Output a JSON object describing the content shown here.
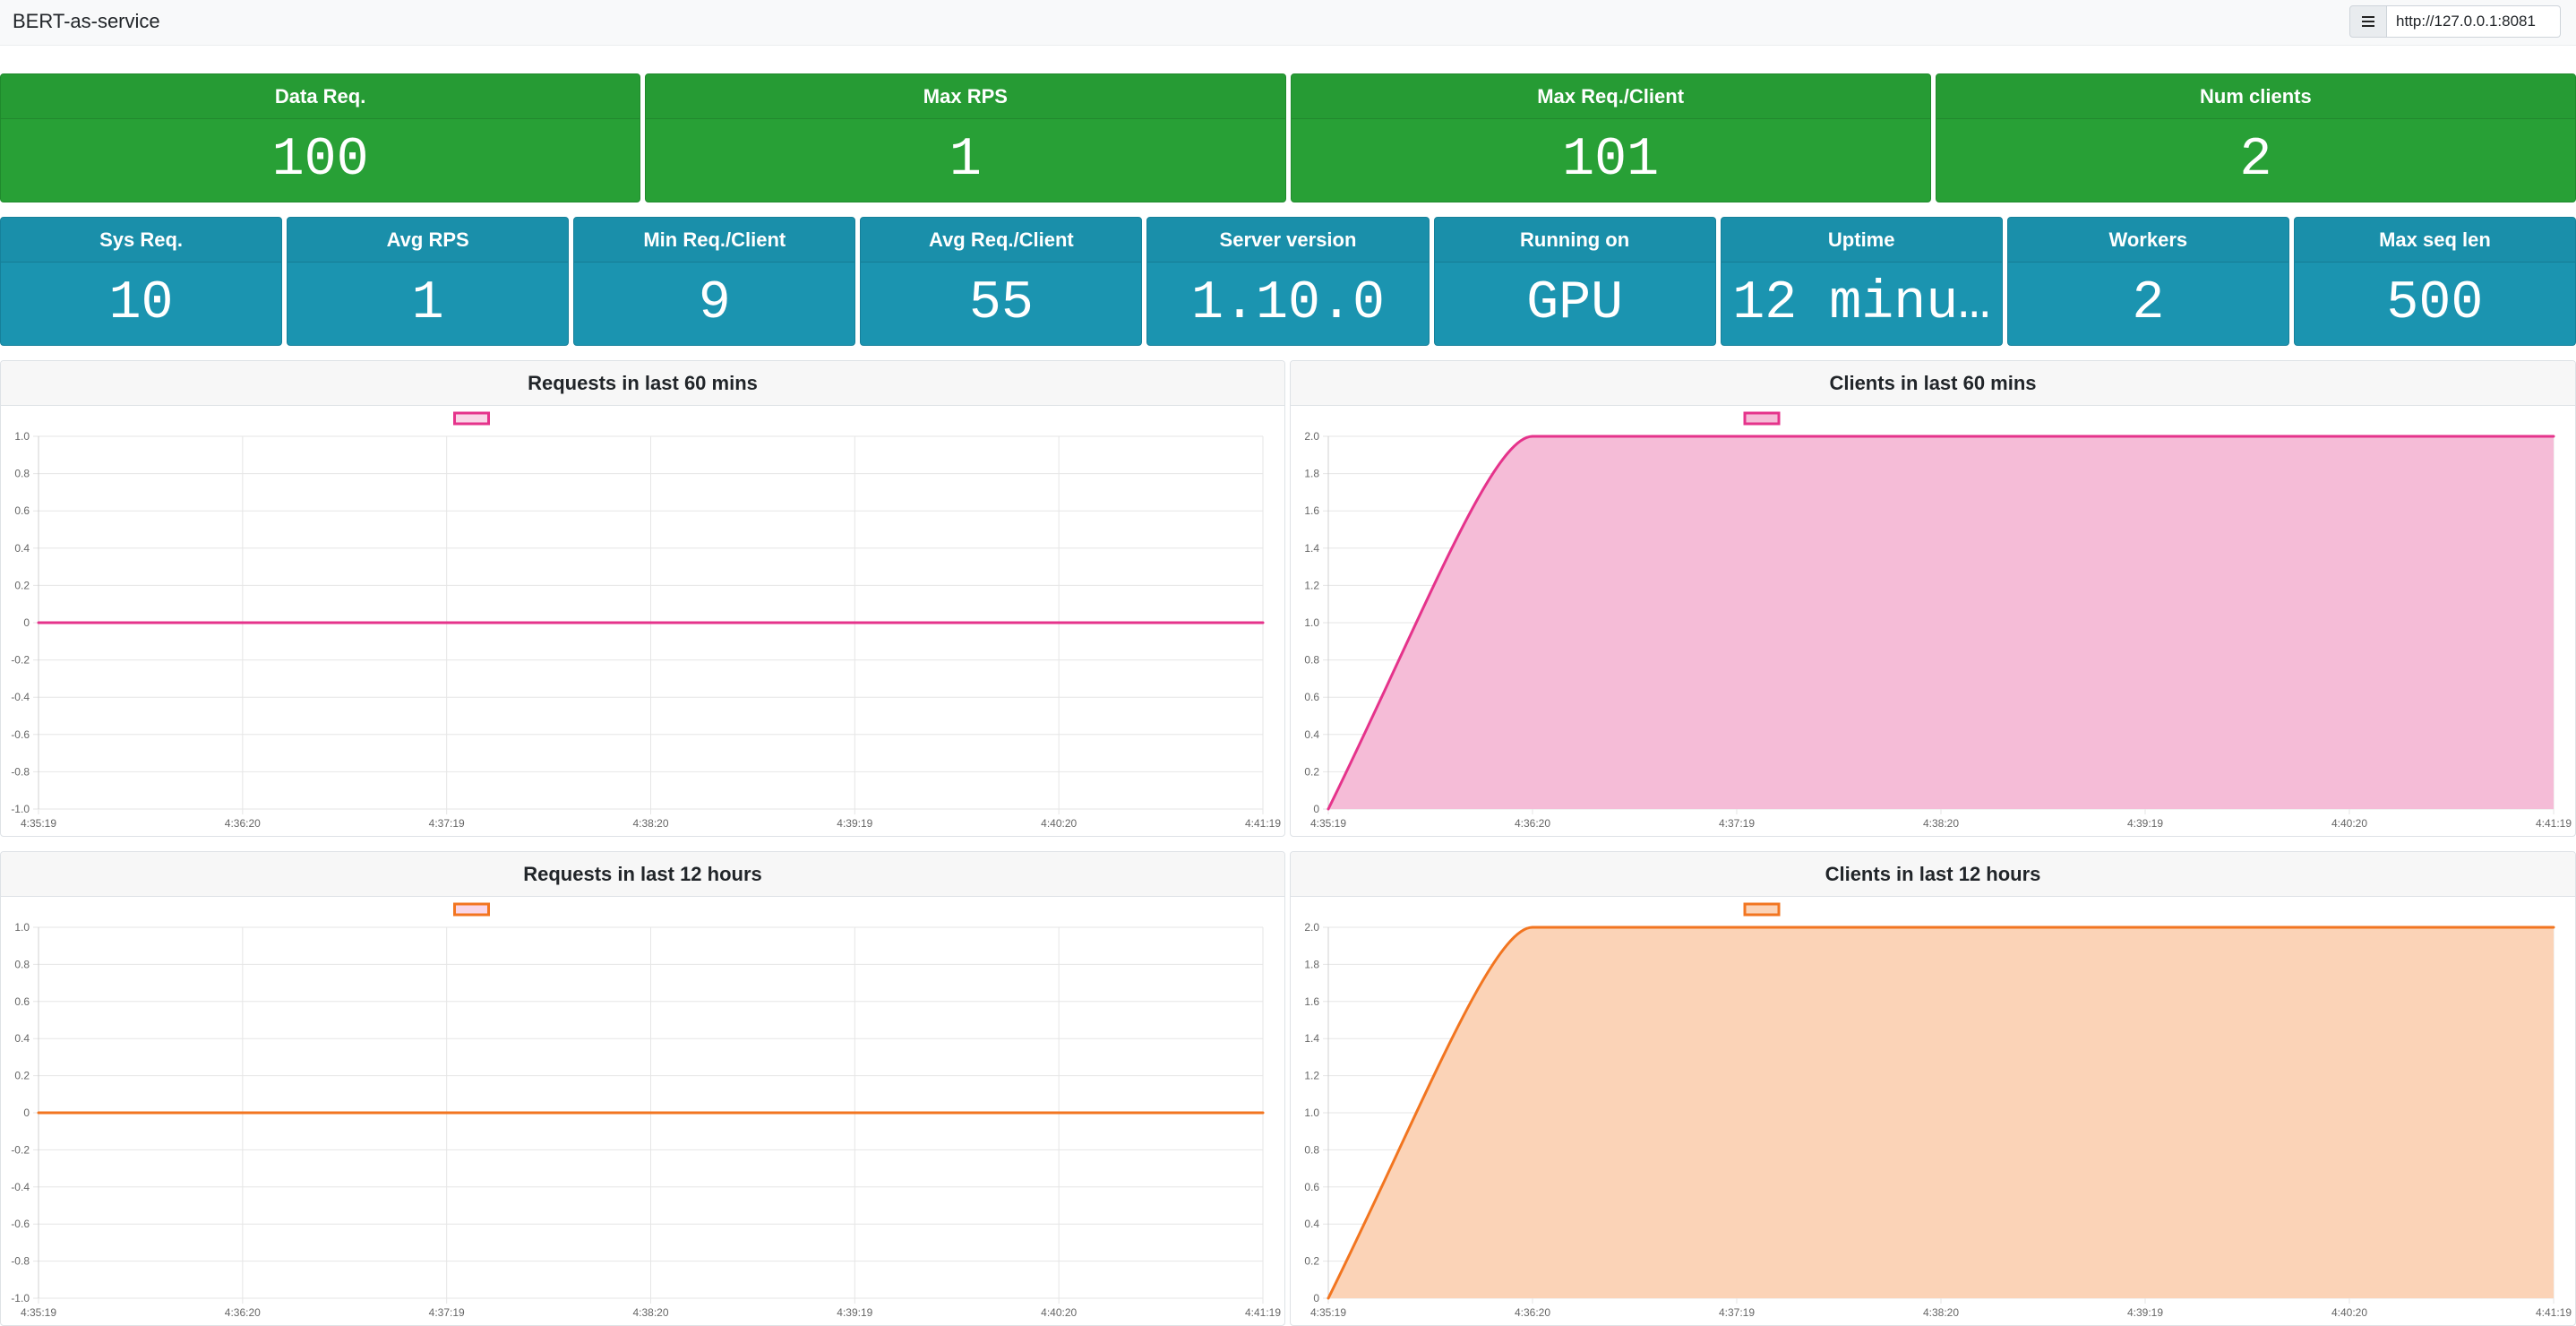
{
  "navbar": {
    "brand": "BERT-as-service",
    "url_value": "http://127.0.0.1:8081"
  },
  "stats_primary": [
    {
      "label": "Data Req.",
      "value": "100"
    },
    {
      "label": "Max RPS",
      "value": "1"
    },
    {
      "label": "Max Req./Client",
      "value": "101"
    },
    {
      "label": "Num clients",
      "value": "2"
    }
  ],
  "stats_secondary": [
    {
      "label": "Sys Req.",
      "value": "10"
    },
    {
      "label": "Avg RPS",
      "value": "1"
    },
    {
      "label": "Min Req./Client",
      "value": "9"
    },
    {
      "label": "Avg Req./Client",
      "value": "55"
    },
    {
      "label": "Server version",
      "value": "1.10.0"
    },
    {
      "label": "Running on",
      "value": "GPU"
    },
    {
      "label": "Uptime",
      "value": "12 minu…"
    },
    {
      "label": "Workers",
      "value": "2"
    },
    {
      "label": "Max seq len",
      "value": "500"
    }
  ],
  "colors": {
    "green": "#28a036",
    "teal": "#1b94b0",
    "pink_line": "#e5338b",
    "pink_fill": "#f5bcd7",
    "orange_line": "#f27520",
    "orange_fill": "#fbd3b7"
  },
  "chart_data": [
    {
      "id": "req60",
      "title": "Requests in last 60 mins",
      "type": "line",
      "x": [
        "4:35:19",
        "4:36:20",
        "4:37:19",
        "4:38:20",
        "4:39:19",
        "4:40:20",
        "4:41:19"
      ],
      "series": [
        {
          "values": [
            0,
            0,
            0,
            0,
            0,
            0,
            0
          ],
          "fill": false,
          "color": "#e5338b"
        }
      ],
      "ylim": [
        -1.0,
        1.0
      ],
      "yticks": [
        "1.0",
        "0.8",
        "0.6",
        "0.4",
        "0.2",
        "0",
        "-0.2",
        "-0.4",
        "-0.6",
        "-0.8",
        "-1.0"
      ],
      "legend": "top-center",
      "grid": true
    },
    {
      "id": "cli60",
      "title": "Clients in last 60 mins",
      "type": "area",
      "x": [
        "4:35:19",
        "4:36:20",
        "4:37:19",
        "4:38:20",
        "4:39:19",
        "4:40:20",
        "4:41:19"
      ],
      "series": [
        {
          "values": [
            0,
            2,
            2,
            2,
            2,
            2,
            2
          ],
          "fill": true,
          "color": "#e5338b",
          "fillColor": "#f5bcd7"
        }
      ],
      "ylim": [
        0,
        2.0
      ],
      "yticks": [
        "2.0",
        "1.8",
        "1.6",
        "1.4",
        "1.2",
        "1.0",
        "0.8",
        "0.6",
        "0.4",
        "0.2",
        "0"
      ],
      "legend": "top-center",
      "grid": true
    },
    {
      "id": "req12",
      "title": "Requests in last 12 hours",
      "type": "line",
      "x": [
        "4:35:19",
        "4:36:20",
        "4:37:19",
        "4:38:20",
        "4:39:19",
        "4:40:20",
        "4:41:19"
      ],
      "series": [
        {
          "values": [
            0,
            0,
            0,
            0,
            0,
            0,
            0
          ],
          "fill": false,
          "color": "#f27520"
        }
      ],
      "ylim": [
        -1.0,
        1.0
      ],
      "yticks": [
        "1.0",
        "0.8",
        "0.6",
        "0.4",
        "0.2",
        "0",
        "-0.2",
        "-0.4",
        "-0.6",
        "-0.8",
        "-1.0"
      ],
      "legend": "top-center",
      "grid": true
    },
    {
      "id": "cli12",
      "title": "Clients in last 12 hours",
      "type": "area",
      "x": [
        "4:35:19",
        "4:36:20",
        "4:37:19",
        "4:38:20",
        "4:39:19",
        "4:40:20",
        "4:41:19"
      ],
      "series": [
        {
          "values": [
            0,
            2,
            2,
            2,
            2,
            2,
            2
          ],
          "fill": true,
          "color": "#f27520",
          "fillColor": "#fbd3b7"
        }
      ],
      "ylim": [
        0,
        2.0
      ],
      "yticks": [
        "2.0",
        "1.8",
        "1.6",
        "1.4",
        "1.2",
        "1.0",
        "0.8",
        "0.6",
        "0.4",
        "0.2",
        "0"
      ],
      "legend": "top-center",
      "grid": true
    }
  ]
}
